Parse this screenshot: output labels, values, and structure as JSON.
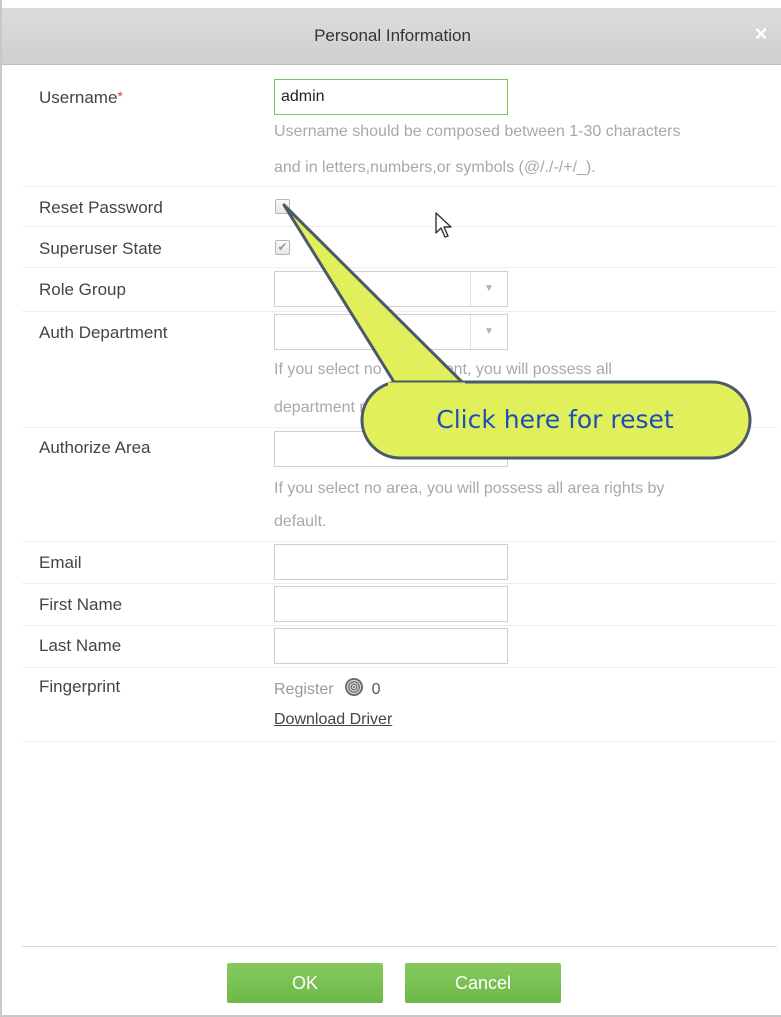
{
  "dialog": {
    "title": "Personal Information",
    "close_glyph": "×"
  },
  "form": {
    "username": {
      "label": "Username",
      "required_mark": "*",
      "value": "admin",
      "hint_line1": "Username should be composed between 1-30 characters",
      "hint_line2": "and in letters,numbers,or symbols (@/./-/+/_)."
    },
    "reset_password": {
      "label": "Reset Password",
      "checked": false
    },
    "superuser_state": {
      "label": "Superuser State",
      "checked": true,
      "check_glyph": "✔"
    },
    "role_group": {
      "label": "Role Group",
      "value": "",
      "arrow": "▼"
    },
    "auth_department": {
      "label": "Auth Department",
      "value": "",
      "arrow": "▼",
      "hint_line1": "If you select no department, you will possess all",
      "hint_line2": "department rights by default."
    },
    "authorize_area": {
      "label": "Authorize Area",
      "value": "",
      "hint_line1": "If you select no area, you will possess all area rights by",
      "hint_line2": "default."
    },
    "email": {
      "label": "Email",
      "value": ""
    },
    "first_name": {
      "label": "First Name",
      "value": ""
    },
    "last_name": {
      "label": "Last Name",
      "value": ""
    },
    "fingerprint": {
      "label": "Fingerprint",
      "register_text": "Register",
      "count": "0",
      "download_link": "Download Driver"
    }
  },
  "buttons": {
    "ok": "OK",
    "cancel": "Cancel"
  },
  "callout": {
    "text": "Click here for reset",
    "fill": "#e1f05a",
    "border": "#4a5a6a",
    "text_color": "#1c4fb8"
  },
  "colors": {
    "accent_green": "#6db848",
    "title_bar": "#d4d4d4",
    "required": "#e53935"
  },
  "icons": {
    "close": "close-icon",
    "fingerprint": "fingerprint-icon",
    "cursor": "mouse-pointer-icon",
    "dropdown": "chevron-down-icon"
  }
}
